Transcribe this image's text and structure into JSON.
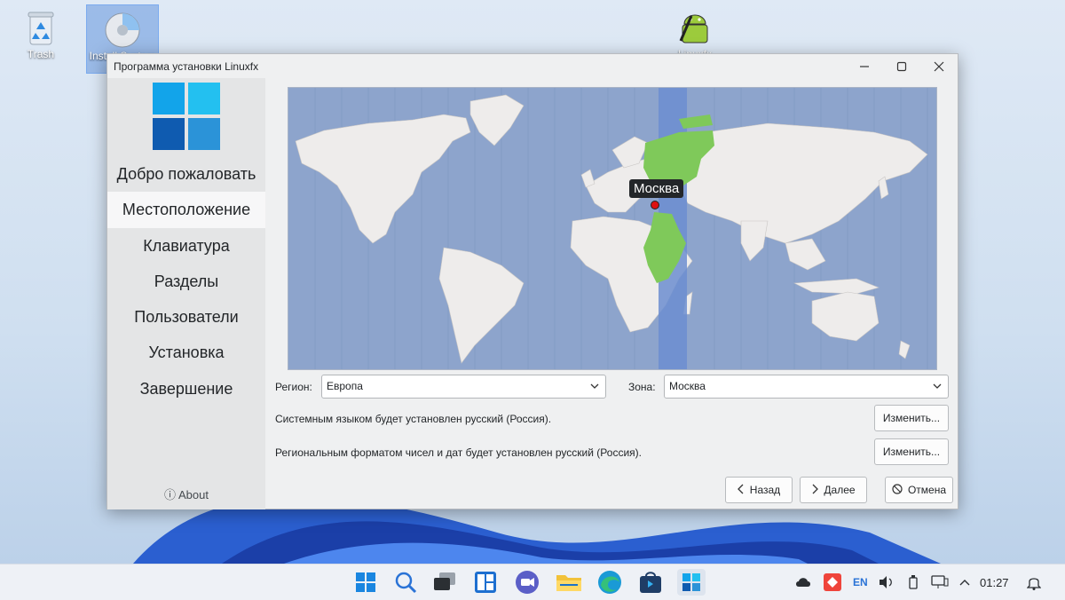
{
  "desktop": {
    "icons": [
      {
        "label": "Trash"
      },
      {
        "label": "Install System"
      },
      {
        "label": "Linuxfx Android"
      }
    ]
  },
  "window": {
    "title": "Программа установки Linuxfx",
    "sidebar": {
      "steps": [
        {
          "label": "Добро пожаловать",
          "active": false
        },
        {
          "label": "Местоположение",
          "active": true
        },
        {
          "label": "Клавиатура",
          "active": false
        },
        {
          "label": "Разделы",
          "active": false
        },
        {
          "label": "Пользователи",
          "active": false
        },
        {
          "label": "Установка",
          "active": false
        },
        {
          "label": "Завершение",
          "active": false
        }
      ],
      "about_label": "About"
    },
    "map": {
      "selected_city": "Москва",
      "highlight_color": "#7fc95a"
    },
    "region_label": "Регион:",
    "region_value": "Европа",
    "zone_label": "Зона:",
    "zone_value": "Москва",
    "language_text": "Системным языком будет установлен русский (Россия).",
    "format_text": "Региональным форматом чисел и дат будет установлен русский (Россия).",
    "change_label": "Изменить...",
    "back_label": "Назад",
    "next_label": "Далее",
    "cancel_label": "Отмена"
  },
  "taskbar": {
    "apps": [
      "start-icon",
      "search-icon",
      "task-view-icon",
      "widgets-icon",
      "chat-icon",
      "file-explorer-icon",
      "edge-icon",
      "store-icon",
      "installer-icon"
    ],
    "language": "EN",
    "time": "01:27"
  }
}
